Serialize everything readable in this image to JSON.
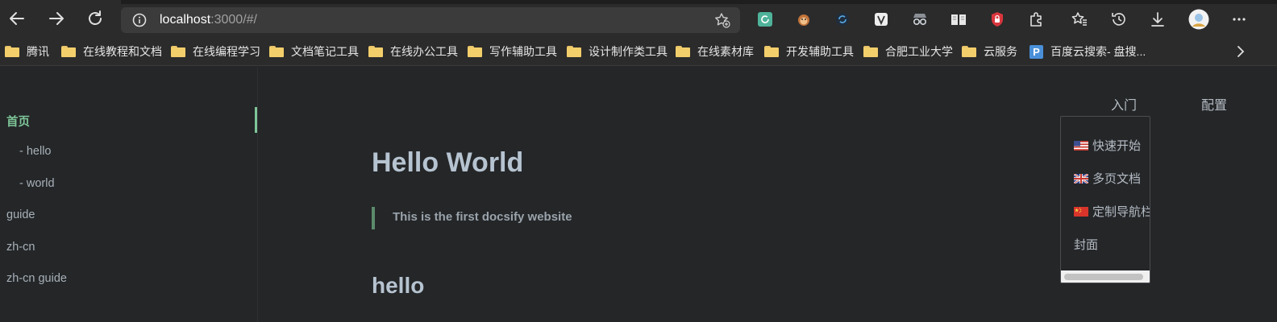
{
  "browser": {
    "url_host": "localhost",
    "url_rest": ":3000/#/",
    "extensions": [
      "refresh-ext-icon",
      "monkey-ext-icon",
      "sync-ext-icon",
      "v-ext-icon",
      "spy-ext-icon",
      "reader-ext-icon",
      "lock-ext-icon",
      "puzzle-icon",
      "favorites-icon",
      "history-icon",
      "download-icon",
      "profile-avatar",
      "more-icon"
    ]
  },
  "bookmarks": [
    {
      "label": "腾讯",
      "icon": "folder-icon"
    },
    {
      "label": "在线教程和文档",
      "icon": "folder-icon"
    },
    {
      "label": "在线编程学习",
      "icon": "folder-icon"
    },
    {
      "label": "文档笔记工具",
      "icon": "folder-icon"
    },
    {
      "label": "在线办公工具",
      "icon": "folder-icon"
    },
    {
      "label": "写作辅助工具",
      "icon": "folder-icon"
    },
    {
      "label": "设计制作类工具",
      "icon": "folder-icon"
    },
    {
      "label": "在线素材库",
      "icon": "folder-icon"
    },
    {
      "label": "开发辅助工具",
      "icon": "folder-icon"
    },
    {
      "label": "合肥工业大学",
      "icon": "folder-icon"
    },
    {
      "label": "云服务",
      "icon": "folder-icon"
    },
    {
      "label": "百度云搜索- 盘搜...",
      "icon": "pansou-icon"
    }
  ],
  "sidebar": {
    "items": [
      "首页",
      "- hello",
      "- world",
      "guide",
      "zh-cn",
      "zh-cn guide"
    ],
    "active_color": "#7ec699"
  },
  "topnav": {
    "intro": "入门",
    "config": "配置"
  },
  "dropdown": {
    "items": [
      "快速开始",
      "多页文档",
      "定制导航栏",
      "封面"
    ],
    "flags": [
      "us-flag-icon",
      "uk-flag-icon",
      "cn-flag-icon"
    ]
  },
  "main": {
    "title": "Hello World",
    "quote": "This is the first docsify website",
    "subtitle": "hello"
  }
}
